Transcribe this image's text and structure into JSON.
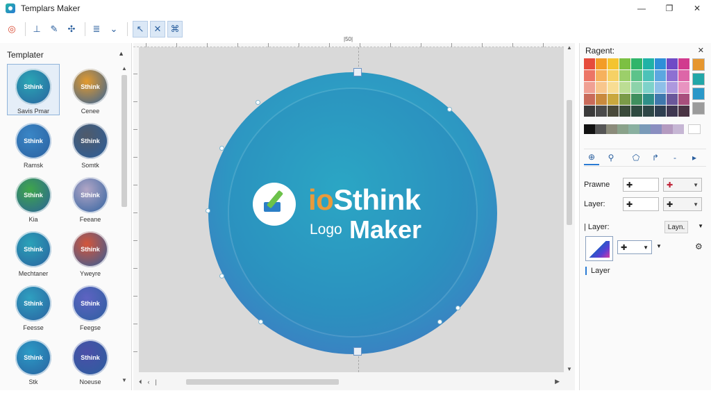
{
  "window": {
    "title": "Templars Maker",
    "controls": {
      "minimize": "—",
      "maximize": "❐",
      "close": "✕"
    }
  },
  "toolbar": {
    "tools": [
      {
        "name": "color-wheel-icon",
        "glyph": "◎"
      },
      {
        "name": "anchor-tool-icon",
        "glyph": "⊥"
      },
      {
        "name": "pen-tool-icon",
        "glyph": "✎"
      },
      {
        "name": "align-center-icon",
        "glyph": "✣"
      },
      {
        "name": "list-icon",
        "glyph": "≣"
      },
      {
        "name": "chevron-down-icon",
        "glyph": "⌄"
      }
    ],
    "active_tools": [
      {
        "name": "select-tool-icon",
        "glyph": "↖"
      },
      {
        "name": "crop-tool-icon",
        "glyph": "✕"
      },
      {
        "name": "node-tool-icon",
        "glyph": "⌘"
      }
    ]
  },
  "templates": {
    "title": "Templater",
    "items": [
      {
        "label": "Savis Pmar",
        "color": "#2aa7b5",
        "selected": true
      },
      {
        "label": "Cenee",
        "color": "#e39a2d",
        "selected": false
      },
      {
        "label": "Ramsk",
        "color": "#3a86c6",
        "selected": false
      },
      {
        "label": "Somtk",
        "color": "#4f5a6a",
        "selected": false
      },
      {
        "label": "Kia",
        "color": "#3fa64a",
        "selected": false
      },
      {
        "label": "Feeane",
        "color": "#b2a6c6",
        "selected": false
      },
      {
        "label": "Mechtaner",
        "color": "#2aa2b8",
        "selected": false
      },
      {
        "label": "Yweyre",
        "color": "#d4553a",
        "selected": false
      },
      {
        "label": "Feesse",
        "color": "#2fa0c0",
        "selected": false
      },
      {
        "label": "Feegse",
        "color": "#5e63c2",
        "selected": false
      },
      {
        "label": "Stk",
        "color": "#2b9bc6",
        "selected": false
      },
      {
        "label": "Noeuse",
        "color": "#4b4fa8",
        "selected": false
      }
    ],
    "thumb_text": "Sthink"
  },
  "canvas": {
    "ruler_label": "|50|",
    "logo": {
      "line1_accent": "io",
      "line1_main": "Sthink",
      "line2_small": "Logo",
      "line2_big": "Maker"
    }
  },
  "right_panel": {
    "title": "Ragent:",
    "palette": [
      "#e64b3c",
      "#f39c27",
      "#f4c430",
      "#7cc043",
      "#30b56a",
      "#1fb2a6",
      "#2e8fd8",
      "#6f4bc6",
      "#d13b8e",
      "#ec7566",
      "#f6b15d",
      "#f6d165",
      "#9ccf6a",
      "#5cc38a",
      "#4cc2b8",
      "#5ca7e0",
      "#8d70d2",
      "#dd66a8",
      "#f0a093",
      "#f8c68c",
      "#f8dd93",
      "#bcdd94",
      "#8cd3aa",
      "#7dd2ca",
      "#8ebfe8",
      "#ad98de",
      "#e893c0",
      "#c96b5a",
      "#c98a3e",
      "#c9a83e",
      "#7a9a48",
      "#3f8f5e",
      "#2f8f88",
      "#3f78ad",
      "#6a579a",
      "#a84f7c",
      "#3a3a3a",
      "#4a4a4a",
      "#4a4a3a",
      "#3a4a3a",
      "#2e4a40",
      "#2e4646",
      "#2e3e50",
      "#3e3650",
      "#4a3444"
    ],
    "side_swatches": [
      "#e6962e",
      "#22a7a8",
      "#2a98c8",
      "#9b9b9b"
    ],
    "grey_row": [
      "#111111",
      "#555555",
      "#8b8b7a",
      "#8aa28a",
      "#8ab0a0",
      "#7a9ab8",
      "#8a8ec0",
      "#b49ac0",
      "#c6b6d4"
    ],
    "tabs": [
      {
        "name": "fill-tab-icon",
        "glyph": "⊕"
      },
      {
        "name": "pin-tab-icon",
        "glyph": "⚲"
      },
      {
        "name": "shape-tab-icon",
        "glyph": "⬠"
      },
      {
        "name": "rotate-tab-icon",
        "glyph": "↱"
      },
      {
        "name": "minus-tab-icon",
        "glyph": "-"
      },
      {
        "name": "play-tab-icon",
        "glyph": "▸"
      }
    ],
    "rows": [
      {
        "label": "Prawne",
        "value": "✚"
      },
      {
        "label": "Layer:",
        "value": "✚"
      }
    ],
    "layers": {
      "header_label": "Layer:",
      "mini_label": "Layn.",
      "select_value": "✚",
      "item_label": "Layer"
    }
  }
}
